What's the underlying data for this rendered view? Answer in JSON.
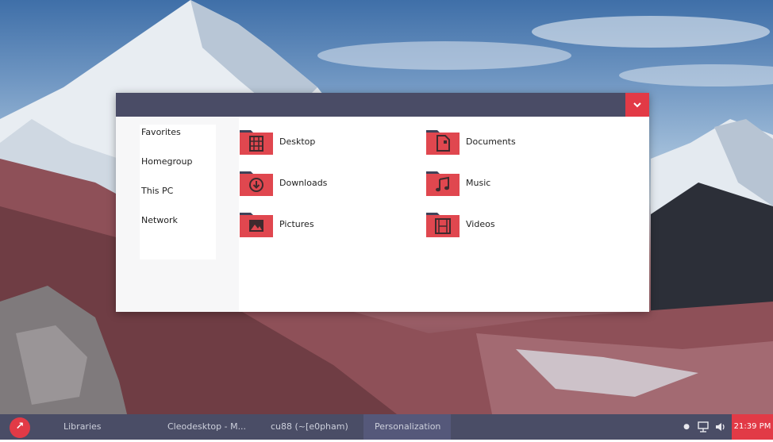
{
  "sidebar": {
    "items": [
      {
        "label": "Favorites"
      },
      {
        "label": "Homegroup"
      },
      {
        "label": "This PC"
      },
      {
        "label": "Network"
      }
    ]
  },
  "folders": [
    {
      "label": "Desktop",
      "icon": "desktop-folder-icon"
    },
    {
      "label": "Documents",
      "icon": "documents-folder-icon"
    },
    {
      "label": "Downloads",
      "icon": "downloads-folder-icon"
    },
    {
      "label": "Music",
      "icon": "music-folder-icon"
    },
    {
      "label": "Pictures",
      "icon": "pictures-folder-icon"
    },
    {
      "label": "Videos",
      "icon": "videos-folder-icon"
    }
  ],
  "taskbar": {
    "tasks": [
      {
        "label": "Libraries"
      },
      {
        "label": "Cleodesktop - M..."
      },
      {
        "label": "cu88 (~[e0pham)..."
      },
      {
        "label": "Personalization"
      }
    ],
    "clock": "21:39 PM"
  },
  "colors": {
    "accent": "#e23a46",
    "titlebar": "#4a4c66",
    "taskbar": "#4a4d66",
    "window_bg": "#ffffff"
  }
}
